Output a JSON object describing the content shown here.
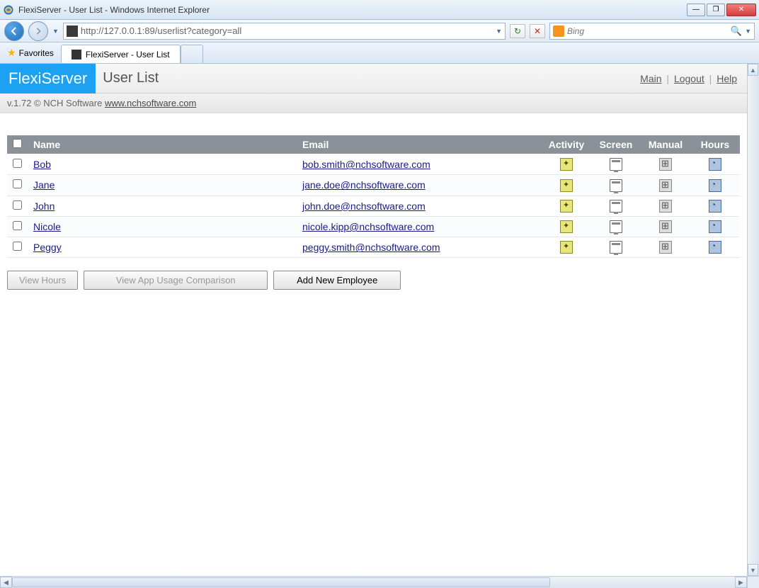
{
  "window": {
    "title": "FlexiServer - User List - Windows Internet Explorer"
  },
  "nav": {
    "url": "http://127.0.0.1:89/userlist?category=all",
    "search_provider": "Bing"
  },
  "favbar": {
    "favorites_label": "Favorites",
    "tab_title": "FlexiServer - User List"
  },
  "page": {
    "logo": "FlexiServer",
    "title": "User List",
    "links": {
      "main": "Main",
      "logout": "Logout",
      "help": "Help"
    },
    "version_prefix": "v.1.72 © NCH Software ",
    "version_link": "www.nchsoftware.com"
  },
  "table": {
    "headers": {
      "name": "Name",
      "email": "Email",
      "activity": "Activity",
      "screen": "Screen",
      "manual": "Manual",
      "hours": "Hours"
    },
    "rows": [
      {
        "name": "Bob",
        "email": "bob.smith@nchsoftware.com"
      },
      {
        "name": "Jane",
        "email": "jane.doe@nchsoftware.com"
      },
      {
        "name": "John",
        "email": "john.doe@nchsoftware.com"
      },
      {
        "name": "Nicole",
        "email": "nicole.kipp@nchsoftware.com"
      },
      {
        "name": "Peggy",
        "email": "peggy.smith@nchsoftware.com"
      }
    ]
  },
  "buttons": {
    "view_hours": "View Hours",
    "view_app": "View App Usage Comparison",
    "add_employee": "Add New Employee"
  }
}
